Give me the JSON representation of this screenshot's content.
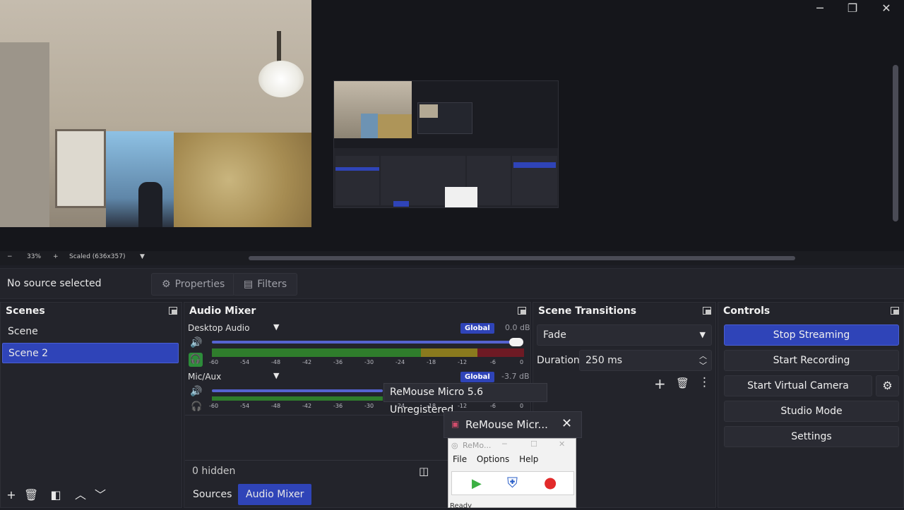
{
  "window": {
    "minimize": "─",
    "maximize": "❐",
    "close": "✕"
  },
  "preview": {
    "zoom": "33%",
    "scale_label": "Scaled (636x357)",
    "zoom_out": "−",
    "zoom_in": "+"
  },
  "source_toolbar": {
    "status": "No source selected",
    "properties": "Properties",
    "filters": "Filters"
  },
  "scenes": {
    "title": "Scenes",
    "items": [
      "Scene",
      "Scene 2"
    ],
    "selected": "Scene 2"
  },
  "audio_mixer": {
    "title": "Audio Mixer",
    "channels": [
      {
        "name": "Desktop Audio",
        "badge": "Global",
        "db": "0.0 dB",
        "volume": 1.0
      },
      {
        "name": "Mic/Aux",
        "badge": "Global",
        "db": "-3.7 dB",
        "volume": 0.85
      }
    ],
    "ticks": [
      "-60",
      "-54",
      "-48",
      "-42",
      "-36",
      "-30",
      "-24",
      "-18",
      "-12",
      "-6",
      "0"
    ],
    "hidden_label": "0 hidden",
    "tabs": [
      "Sources",
      "Audio Mixer"
    ],
    "active_tab": "Audio Mixer"
  },
  "scene_transitions": {
    "title": "Scene Transitions",
    "transition": "Fade",
    "duration_label": "Duration",
    "duration_value": "250 ms"
  },
  "controls": {
    "title": "Controls",
    "stop_streaming": "Stop Streaming",
    "start_recording": "Start Recording",
    "start_virtual_camera": "Start Virtual Camera",
    "studio_mode": "Studio Mode",
    "settings": "Settings"
  },
  "tooltip": "ReMouse Micro 5.6 Unregistered",
  "remouse": {
    "float_title": "ReMouse Micr...",
    "win_title": "ReMo...",
    "menu": [
      "File",
      "Options",
      "Help"
    ],
    "status": "Ready"
  },
  "colors": {
    "accent": "#2f44b8",
    "bg": "#1e1f26",
    "dock": "#23242b",
    "meter_green": "#2f7d2c",
    "meter_yellow": "#8a7a1e",
    "meter_red": "#6e1a24"
  }
}
